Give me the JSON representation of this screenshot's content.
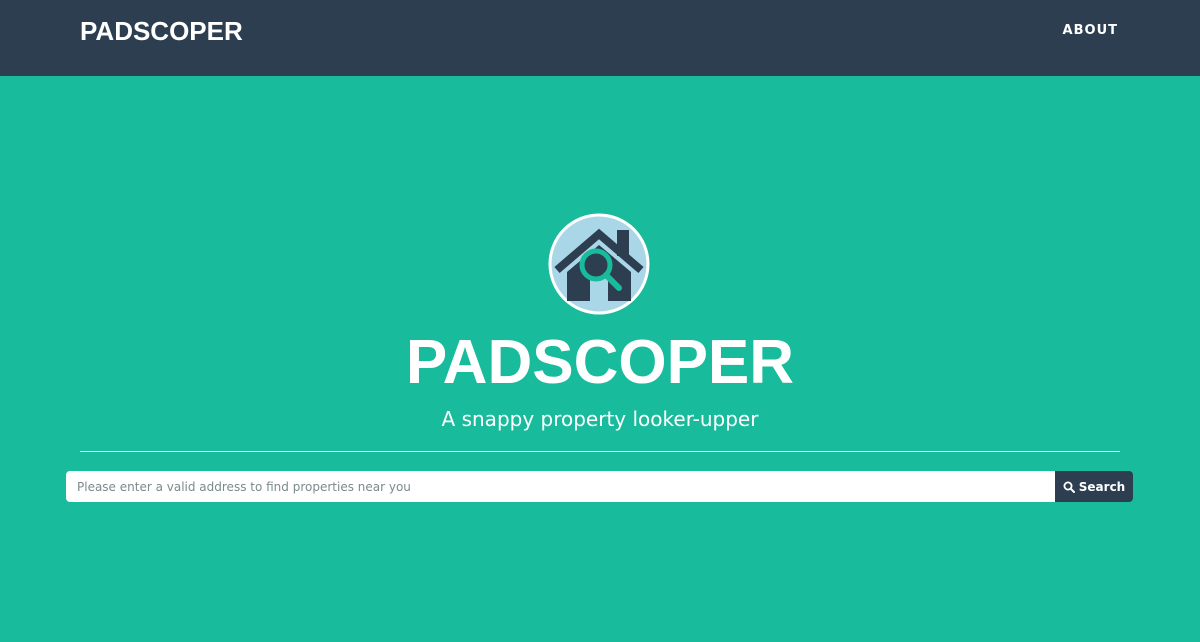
{
  "navbar": {
    "brand": "PADSCOPER",
    "about_label": "ABOUT"
  },
  "hero": {
    "title": "PADSCOPER",
    "subtitle": "A snappy property looker-upper",
    "logo_icon": "house-magnifier-icon"
  },
  "search": {
    "placeholder": "Please enter a valid address to find properties near you",
    "value": "",
    "button_label": "Search",
    "button_icon": "search-icon"
  },
  "colors": {
    "navbar_bg": "#2c3e50",
    "hero_bg": "#18bc9c",
    "logo_circle": "#a9d7e7",
    "house": "#2c3e50",
    "magnifier": "#18bc9c",
    "text": "#ffffff"
  }
}
